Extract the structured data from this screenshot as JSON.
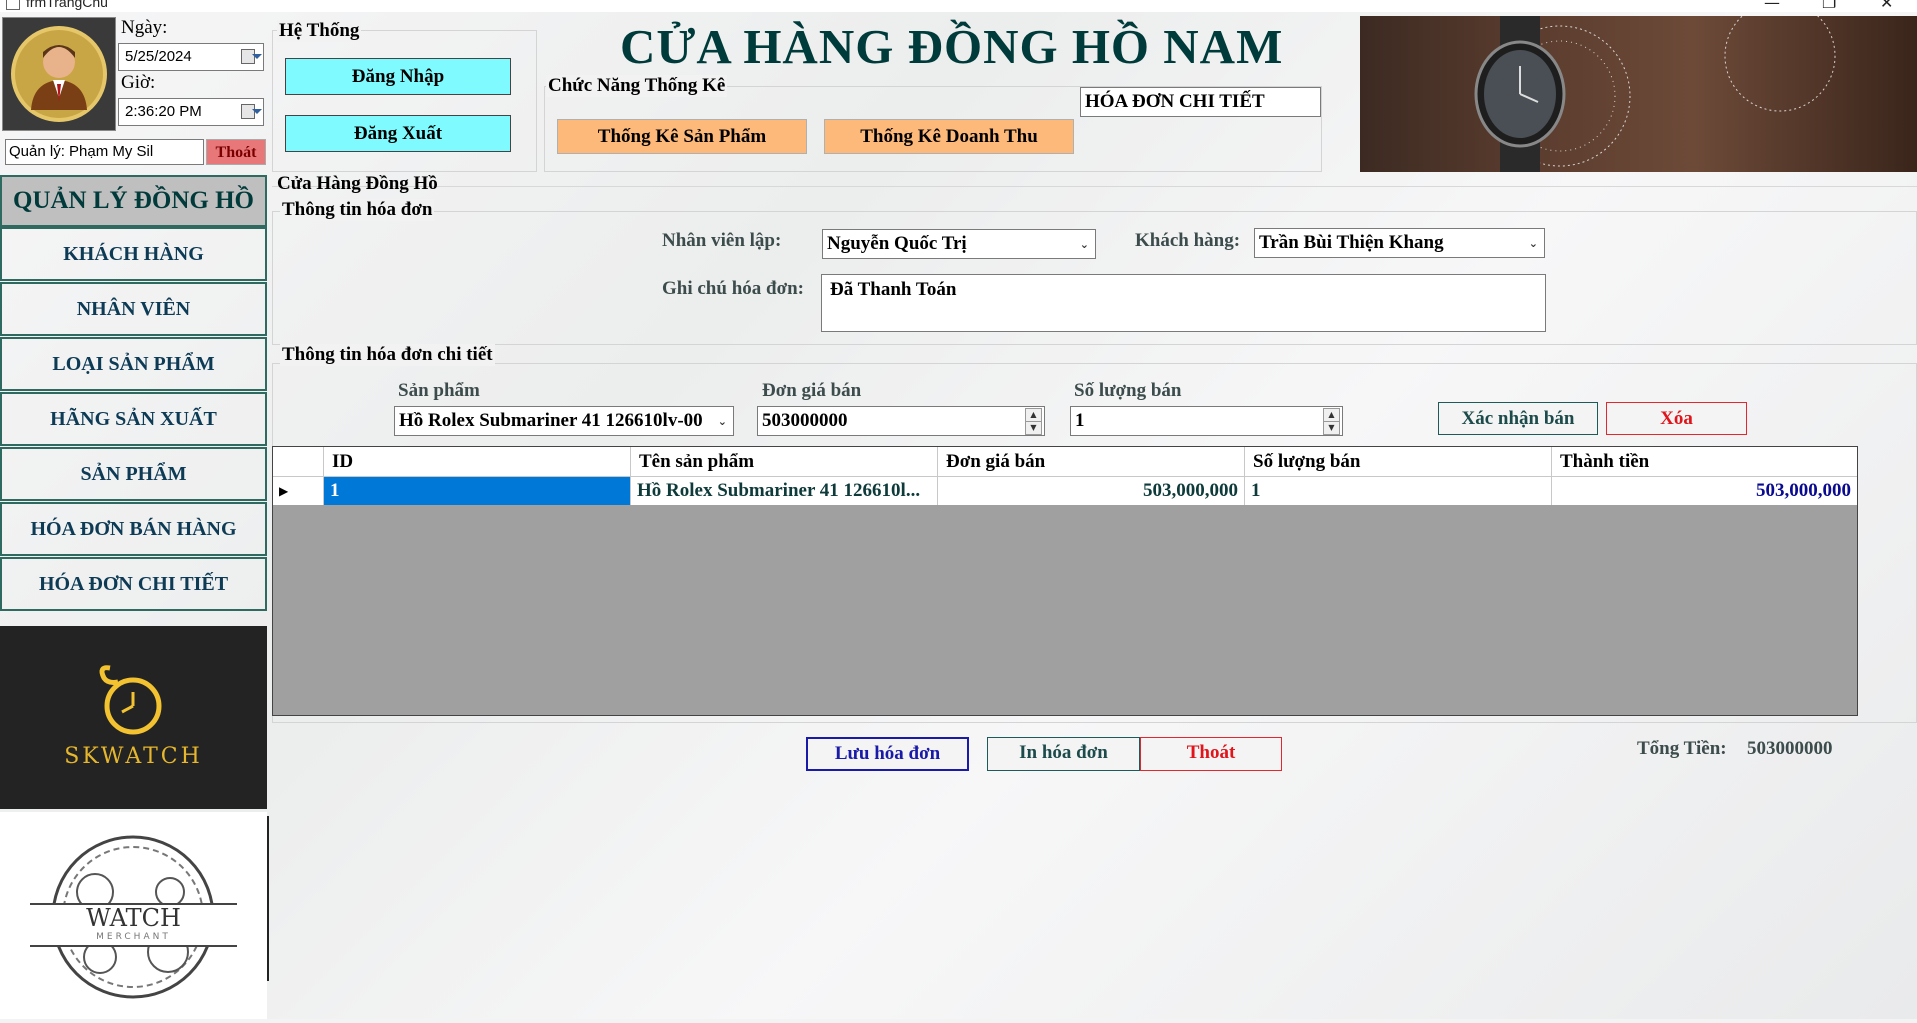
{
  "window": {
    "title": "frmTrangChu"
  },
  "header": {
    "date_label": "Ngày:",
    "date_value": "5/25/2024",
    "time_label": "Giờ:",
    "time_value": "2:36:20 PM",
    "manager_text": "Quản lý: Phạm My Sil",
    "exit_small": "Thoát"
  },
  "system": {
    "group_label": "Hệ Thống",
    "login": "Đăng Nhập",
    "logout": "Đăng Xuất"
  },
  "stats": {
    "group_label": "Chức Năng Thống Kê",
    "products": "Thống Kê Sản Phẩm",
    "revenue": "Thống Kê Doanh Thu"
  },
  "store_title": "CỬA HÀNG ĐỒNG HỒ NAM",
  "current_form": "HÓA ĐƠN CHI TIẾT",
  "nav": {
    "title": "QUẢN LÝ ĐỒNG HỒ",
    "items": [
      "KHÁCH HÀNG",
      "NHÂN VIÊN",
      "LOẠI SẢN PHẨM",
      "HÃNG SẢN XUẤT",
      "SẢN PHẨM",
      "HÓA ĐƠN BÁN HÀNG",
      "HÓA ĐƠN CHI TIẾT"
    ]
  },
  "logos": {
    "skwatch": "SKWATCH",
    "watch": "WATCH",
    "merchant": "MERCHANT"
  },
  "main": {
    "group_label": "Cửa Hàng Đồng Hồ",
    "invoice_info_label": "Thông tin hóa đơn",
    "employee_label": "Nhân viên lập:",
    "employee_value": "Nguyễn Quốc Trị",
    "customer_label": "Khách hàng:",
    "customer_value": "Trần Bùi Thiện Khang",
    "note_label": "Ghi chú hóa đơn:",
    "note_value": "Đã Thanh Toán",
    "detail_label": "Thông tin hóa đơn chi tiết",
    "product_label": "Sản phẩm",
    "product_value": "Hồ Rolex Submariner 41 126610lv-00",
    "price_label": "Đơn giá bán",
    "price_value": "503000000",
    "qty_label": "Số lượng bán",
    "qty_value": "1",
    "confirm_btn": "Xác nhận bán",
    "delete_btn": "Xóa"
  },
  "grid": {
    "columns": [
      "ID",
      "Tên sản phẩm",
      "Đơn giá bán",
      "Số lượng bán",
      "Thành tiền"
    ],
    "rows": [
      {
        "id": "1",
        "name": "Hồ Rolex Submariner 41 126610l...",
        "price": "503,000,000",
        "qty": "1",
        "total": "503,000,000"
      }
    ]
  },
  "footer": {
    "save": "Lưu hóa đơn",
    "print": "In hóa đơn",
    "exit": "Thoát",
    "total_label": "Tổng Tiền:",
    "total_value": "503000000"
  }
}
